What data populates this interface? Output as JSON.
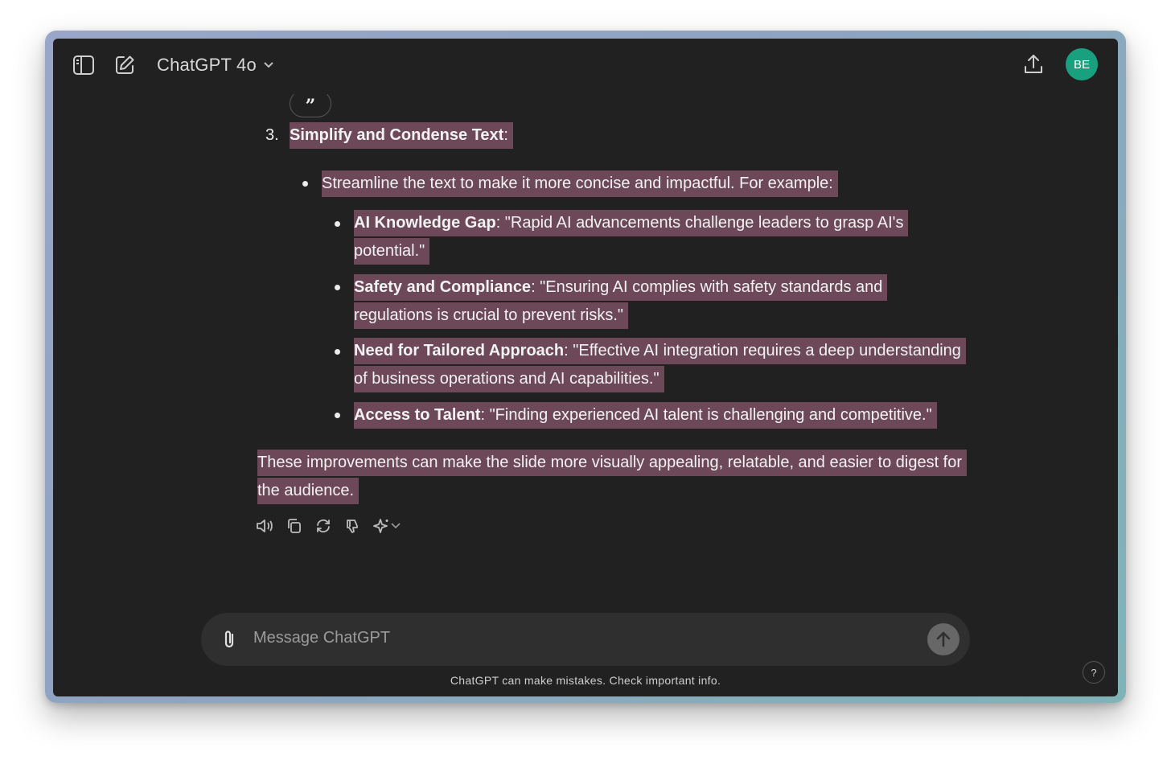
{
  "header": {
    "model_name": "ChatGPT 4o",
    "avatar_initials": "BE"
  },
  "message": {
    "item3": {
      "number": "3.",
      "title": "Simplify and Condense Text",
      "suffix": ":"
    },
    "intro": "Streamline the text to make it more concise and impactful. For example:",
    "examples": [
      {
        "term": "AI Knowledge Gap",
        "line1": ": \"Rapid AI advancements challenge leaders to grasp AI's",
        "line2": "potential.\""
      },
      {
        "term": "Safety and Compliance",
        "line1": ": \"Ensuring AI complies with safety standards and",
        "line2": "regulations is crucial to prevent risks.\""
      },
      {
        "term": "Need for Tailored Approach",
        "line1": ": \"Effective AI integration requires a deep understanding",
        "line2": "of business operations and AI capabilities.\""
      },
      {
        "term": "Access to Talent",
        "line1": ": \"Finding experienced AI talent is challenging and competitive.\""
      }
    ],
    "closing_line1": "These improvements can make the slide more visually appealing, relatable, and easier to digest for",
    "closing_line2": "the audience."
  },
  "composer": {
    "placeholder": "Message ChatGPT"
  },
  "footer": {
    "disclaimer": "ChatGPT can make mistakes. Check important info.",
    "help_label": "?"
  },
  "colors": {
    "background": "#212121",
    "highlight": "#6c4858",
    "avatar": "#19a17f",
    "composer": "#2f2f2f"
  }
}
